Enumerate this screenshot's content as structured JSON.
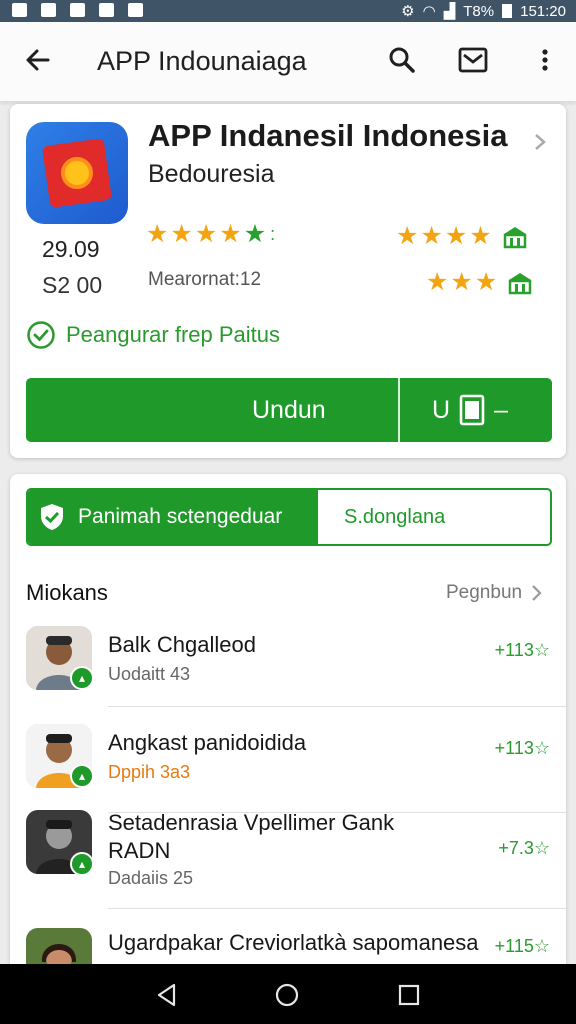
{
  "status_bar": {
    "battery": "T8%",
    "time": "151:20"
  },
  "app_bar": {
    "title": "APP Indounaiaga"
  },
  "app_card": {
    "name": "APP Indanesil Indonesia",
    "developer": "Bedouresia",
    "price_primary": "29.09",
    "price_secondary": "S2 00",
    "reviews": "Mearornat:12",
    "verified": "Peangurar frep Paitus",
    "install_label": "Undun",
    "secondary_button_label": "U",
    "rating_primary": 4.5,
    "rating_secondary": 4,
    "rating_tertiary": 3
  },
  "section": {
    "toggle_selected": "Panimah sctengeduar",
    "toggle_other": "S.donglana",
    "title": "Miokans",
    "link": "Pegnbun"
  },
  "list": [
    {
      "name": "Balk Chgalleod",
      "meta": "Uodaitt 43",
      "meta_style": "gray",
      "rating": "+113☆"
    },
    {
      "name": "Angkast panidoidida",
      "meta": "Dppih 3a3",
      "meta_style": "orange",
      "rating": "+113☆"
    },
    {
      "name": "Setadenrasia Vpellimer Gank",
      "name_line2": "RADN",
      "meta": "Dadaiis 25",
      "meta_style": "gray",
      "rating": "+7.3☆"
    },
    {
      "name": "Ugardpakar Creviorlatkà sapomanesa",
      "meta": "",
      "meta_style": "gray",
      "rating": "+115☆"
    }
  ],
  "colors": {
    "accent": "#1f9a2a",
    "star": "#f2a511",
    "status_bar": "#3f5567"
  }
}
